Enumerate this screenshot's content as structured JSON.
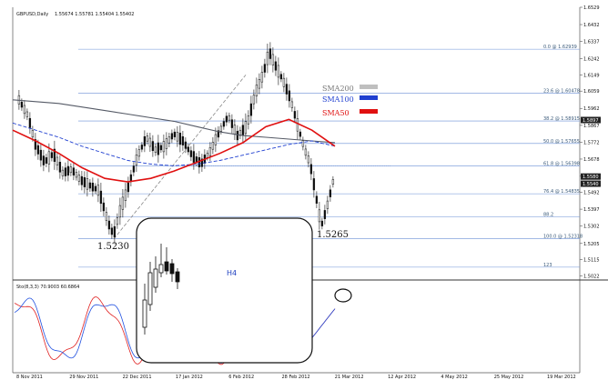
{
  "header": {
    "symbol": "GBPUSD,Daily",
    "ohlc": "1.55674 1.55781 1.55404 1.55402"
  },
  "oscillator": {
    "label": "Sto(8,3,3) 70.9003 60.6864"
  },
  "colors": {
    "candle": "#111111",
    "sma200": "#bfbfbf",
    "sma100": "#1f3fd0",
    "sma50": "#e01010",
    "fib_line": "#6a8fd6",
    "sto_main": "#e02020",
    "sto_signal": "#2050e0",
    "trendline": "#888888"
  },
  "chart_data": [
    {
      "type": "line",
      "title": "GBPUSD,Daily",
      "price_axis_ticks": [
        "1.6529",
        "1.6432",
        "1.6337",
        "1.6242",
        "1.6149",
        "1.6059",
        "1.5962",
        "1.5867",
        "1.5772",
        "1.5678",
        "1.5582",
        "1.5492",
        "1.5397",
        "1.5302",
        "1.5205",
        "1.5115",
        "1.5022"
      ],
      "price_highlights": [
        "1.5897",
        "1.5580",
        "1.5540"
      ],
      "ylim": [
        1.5,
        1.6529
      ],
      "time_axis_ticks": [
        "8 Nov 2011",
        "29 Nov 2011",
        "22 Dec 2011",
        "17 Jan 2012",
        "6 Feb 2012",
        "28 Feb 2012",
        "21 Mar 2012",
        "12 Apr 2012",
        "4 May 2012",
        "25 May 2012",
        "19 Mar 2012"
      ],
      "series": [
        {
          "name": "SMA200",
          "values": [
            1.601,
            1.6,
            1.599,
            1.597,
            1.595,
            1.593,
            1.591,
            1.589,
            1.586,
            1.583,
            1.581,
            1.58,
            1.579,
            1.578,
            1.577
          ]
        },
        {
          "name": "SMA100",
          "values": [
            1.588,
            1.584,
            1.58,
            1.575,
            1.571,
            1.567,
            1.565,
            1.564,
            1.565,
            1.567,
            1.57,
            1.573,
            1.576,
            1.578,
            1.575
          ]
        },
        {
          "name": "SMA50",
          "values": [
            1.584,
            1.578,
            1.571,
            1.563,
            1.557,
            1.555,
            1.557,
            1.561,
            1.566,
            1.571,
            1.577,
            1.586,
            1.59,
            1.584,
            1.575
          ]
        }
      ],
      "fibonacci_levels": [
        {
          "label": "0.0 @ 1.62939",
          "value": 1.62939
        },
        {
          "label": "23.6 @ 1.60478",
          "value": 1.60478
        },
        {
          "label": "38.2 @ 1.58915",
          "value": 1.58915
        },
        {
          "label": "50.0 @ 1.57655",
          "value": 1.57655
        },
        {
          "label": "61.8 @ 1.56398",
          "value": 1.56398
        },
        {
          "label": "76.4 @ 1.54835",
          "value": 1.54835
        },
        {
          "label": "88.2",
          "value": 1.5353
        },
        {
          "label": "100.0 @ 1.52318",
          "value": 1.52318
        },
        {
          "label": "123",
          "value": 1.5072
        }
      ],
      "annotations": [
        "1.5230",
        "1.5265"
      ],
      "legend": [
        "SMA200",
        "SMA100",
        "SMA50"
      ],
      "inset_label": "H4",
      "legend_placement": "top-right",
      "grid": false
    },
    {
      "type": "line",
      "title": "Sto(8,3,3) 70.9003 60.6864",
      "series": [
        {
          "name": "main",
          "values": [
            70.9003
          ]
        },
        {
          "name": "signal",
          "values": [
            60.6864
          ]
        }
      ]
    }
  ]
}
